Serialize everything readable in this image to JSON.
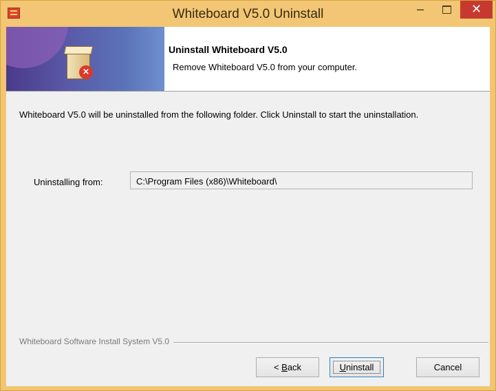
{
  "window": {
    "title": "Whiteboard V5.0 Uninstall",
    "controls": {
      "minimize": "–",
      "close": "✕"
    }
  },
  "header": {
    "title": "Uninstall Whiteboard V5.0",
    "subtitle": "Remove Whiteboard V5.0 from your computer."
  },
  "body": {
    "intro": "Whiteboard V5.0 will be uninstalled from the following folder. Click Uninstall to start the uninstallation.",
    "uninstall_from_label": "Uninstalling from:",
    "uninstall_from_value": "C:\\Program Files (x86)\\Whiteboard\\"
  },
  "footer": {
    "branding": "Whiteboard Software Install System V5.0",
    "buttons": {
      "back": {
        "accel": "B",
        "rest": "ack",
        "prefix": "< "
      },
      "uninstall": {
        "accel": "U",
        "rest": "ninstall"
      },
      "cancel": "Cancel"
    }
  },
  "icons": {
    "app": "whiteboard-app-icon",
    "header": "uninstall-box-icon"
  },
  "colors": {
    "frame": "#f0c674",
    "close": "#c7392e",
    "header_art": "#5b73b8",
    "dialog_bg": "#f0f0f0"
  }
}
